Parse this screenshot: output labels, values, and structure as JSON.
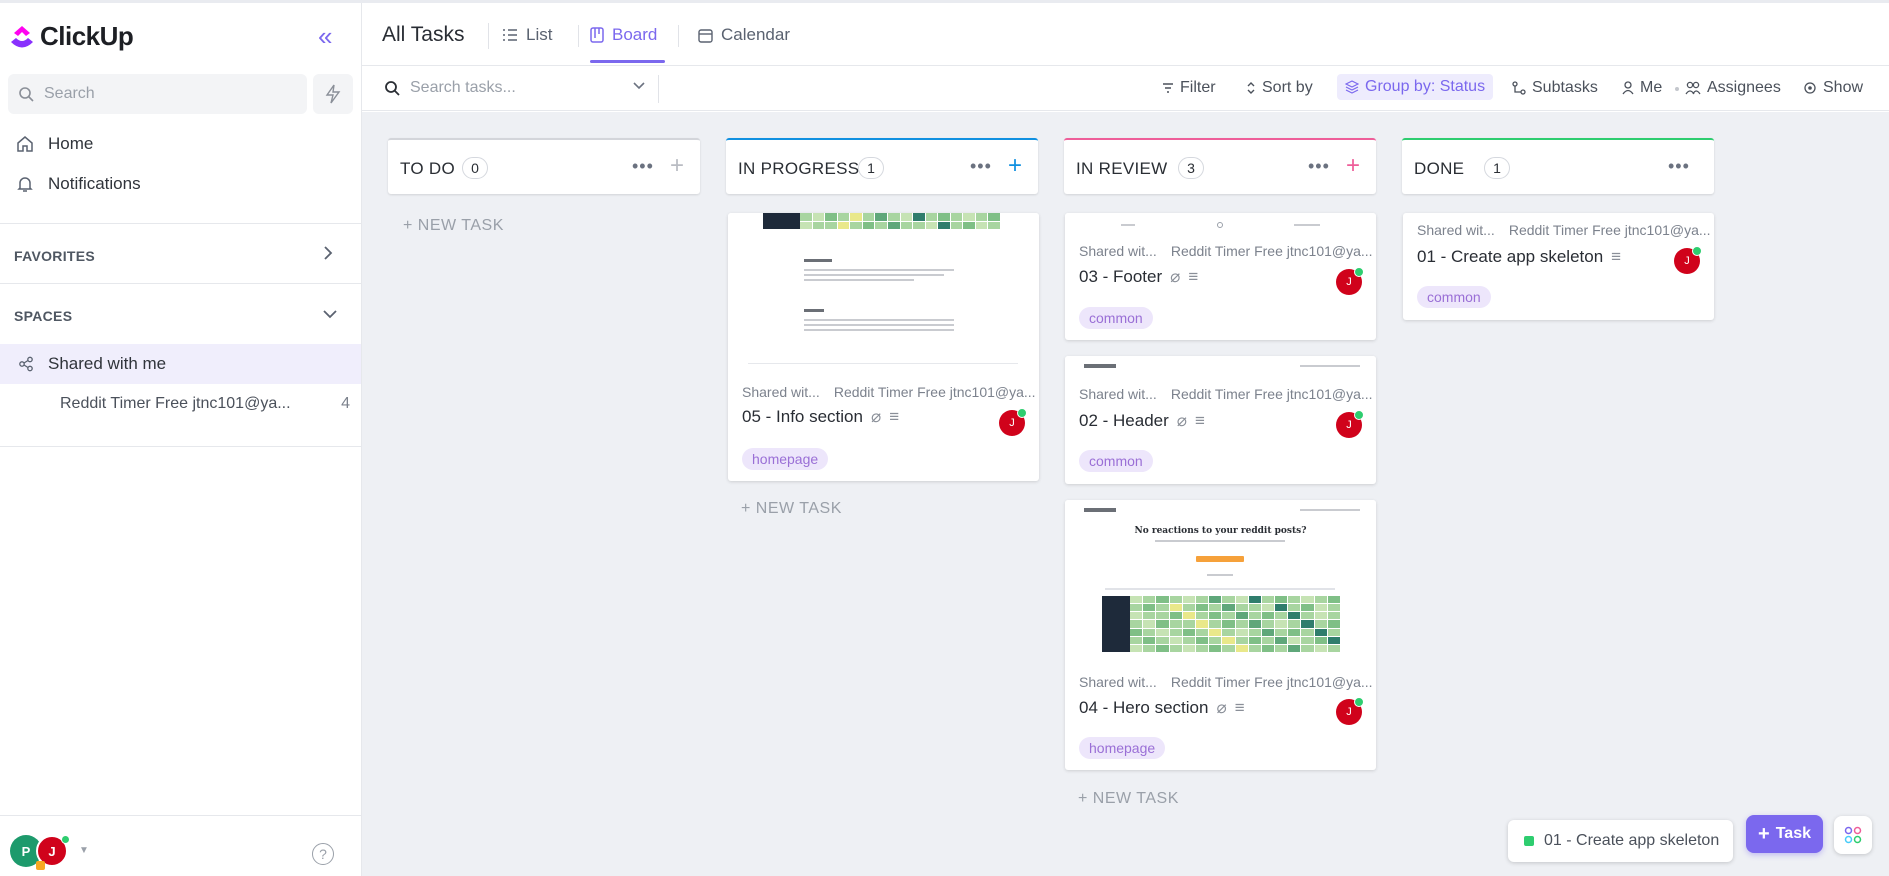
{
  "sidebar": {
    "logo_text": "ClickUp",
    "search_placeholder": "Search",
    "nav": [
      {
        "label": "Home",
        "icon": "home-icon"
      },
      {
        "label": "Notifications",
        "icon": "bell-icon"
      }
    ],
    "favorites_label": "FAVORITES",
    "spaces_label": "SPACES",
    "shared_label": "Shared with me",
    "space_item": {
      "label": "Reddit Timer Free jtnc101@ya...",
      "count": "4"
    },
    "avatars": [
      {
        "initial": "P",
        "color": "#1d9a6c"
      },
      {
        "initial": "J",
        "color": "#d0021b"
      }
    ]
  },
  "header": {
    "title": "All Tasks",
    "tabs": [
      {
        "label": "List"
      },
      {
        "label": "Board"
      },
      {
        "label": "Calendar"
      }
    ],
    "active_tab": "Board"
  },
  "toolbar": {
    "search_placeholder": "Search tasks...",
    "filter": "Filter",
    "sort": "Sort by",
    "group": "Group by: Status",
    "subtasks": "Subtasks",
    "me": "Me",
    "assignees": "Assignees",
    "show": "Show"
  },
  "columns": [
    {
      "title": "TO DO",
      "count": "0",
      "color": "#d3d5da",
      "plus_color": "#b9bcc3",
      "new_task": "+ NEW TASK"
    },
    {
      "title": "IN PROGRESS",
      "count": "1",
      "color": "#1090e0",
      "plus_color": "#1090e0",
      "new_task": "+ NEW TASK"
    },
    {
      "title": "IN REVIEW",
      "count": "3",
      "color": "#ee5e99",
      "plus_color": "#ee5e99",
      "new_task": "+ NEW TASK"
    },
    {
      "title": "DONE",
      "count": "1",
      "color": "#2ecd6f",
      "plus_color": "",
      "new_task": ""
    }
  ],
  "cards": {
    "info": {
      "location": "Shared wit...",
      "list": "Reddit Timer Free jtnc101@ya...",
      "name": "05 - Info section",
      "tag": "homepage",
      "assignee": "J"
    },
    "footer": {
      "location": "Shared wit...",
      "list": "Reddit Timer Free jtnc101@ya...",
      "name": "03 - Footer",
      "tag": "common",
      "assignee": "J"
    },
    "header": {
      "location": "Shared wit...",
      "list": "Reddit Timer Free jtnc101@ya...",
      "name": "02 - Header",
      "tag": "common",
      "assignee": "J"
    },
    "hero": {
      "location": "Shared wit...",
      "list": "Reddit Timer Free jtnc101@ya...",
      "name": "04 - Hero section",
      "tag": "homepage",
      "assignee": "J",
      "preview_heading": "No reactions to your reddit posts?"
    },
    "skeleton": {
      "location": "Shared wit...",
      "list": "Reddit Timer Free jtnc101@ya...",
      "name": "01 - Create app skeleton",
      "tag": "common",
      "assignee": "J"
    }
  },
  "bottom": {
    "tray_label": "01 - Create app skeleton",
    "fab_label": "Task"
  },
  "colors": {
    "accent": "#7b68ee",
    "board_bg": "#eef0f4",
    "assignee": "#d0021b",
    "online": "#2ecd6f"
  }
}
